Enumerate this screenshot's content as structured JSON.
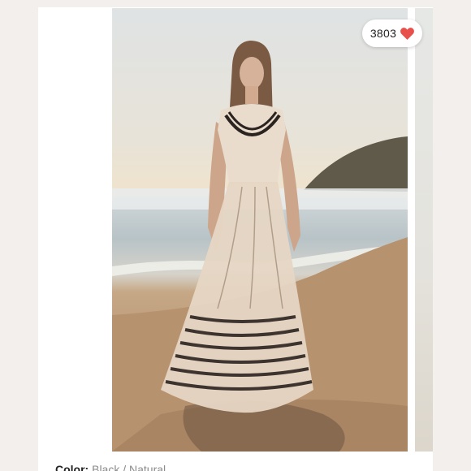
{
  "listing": {
    "likes": {
      "count": "3803",
      "icon": "heart-icon",
      "icon_color": "#e8514b"
    },
    "color": {
      "label": "Color:",
      "value": "Black / Natural"
    }
  }
}
